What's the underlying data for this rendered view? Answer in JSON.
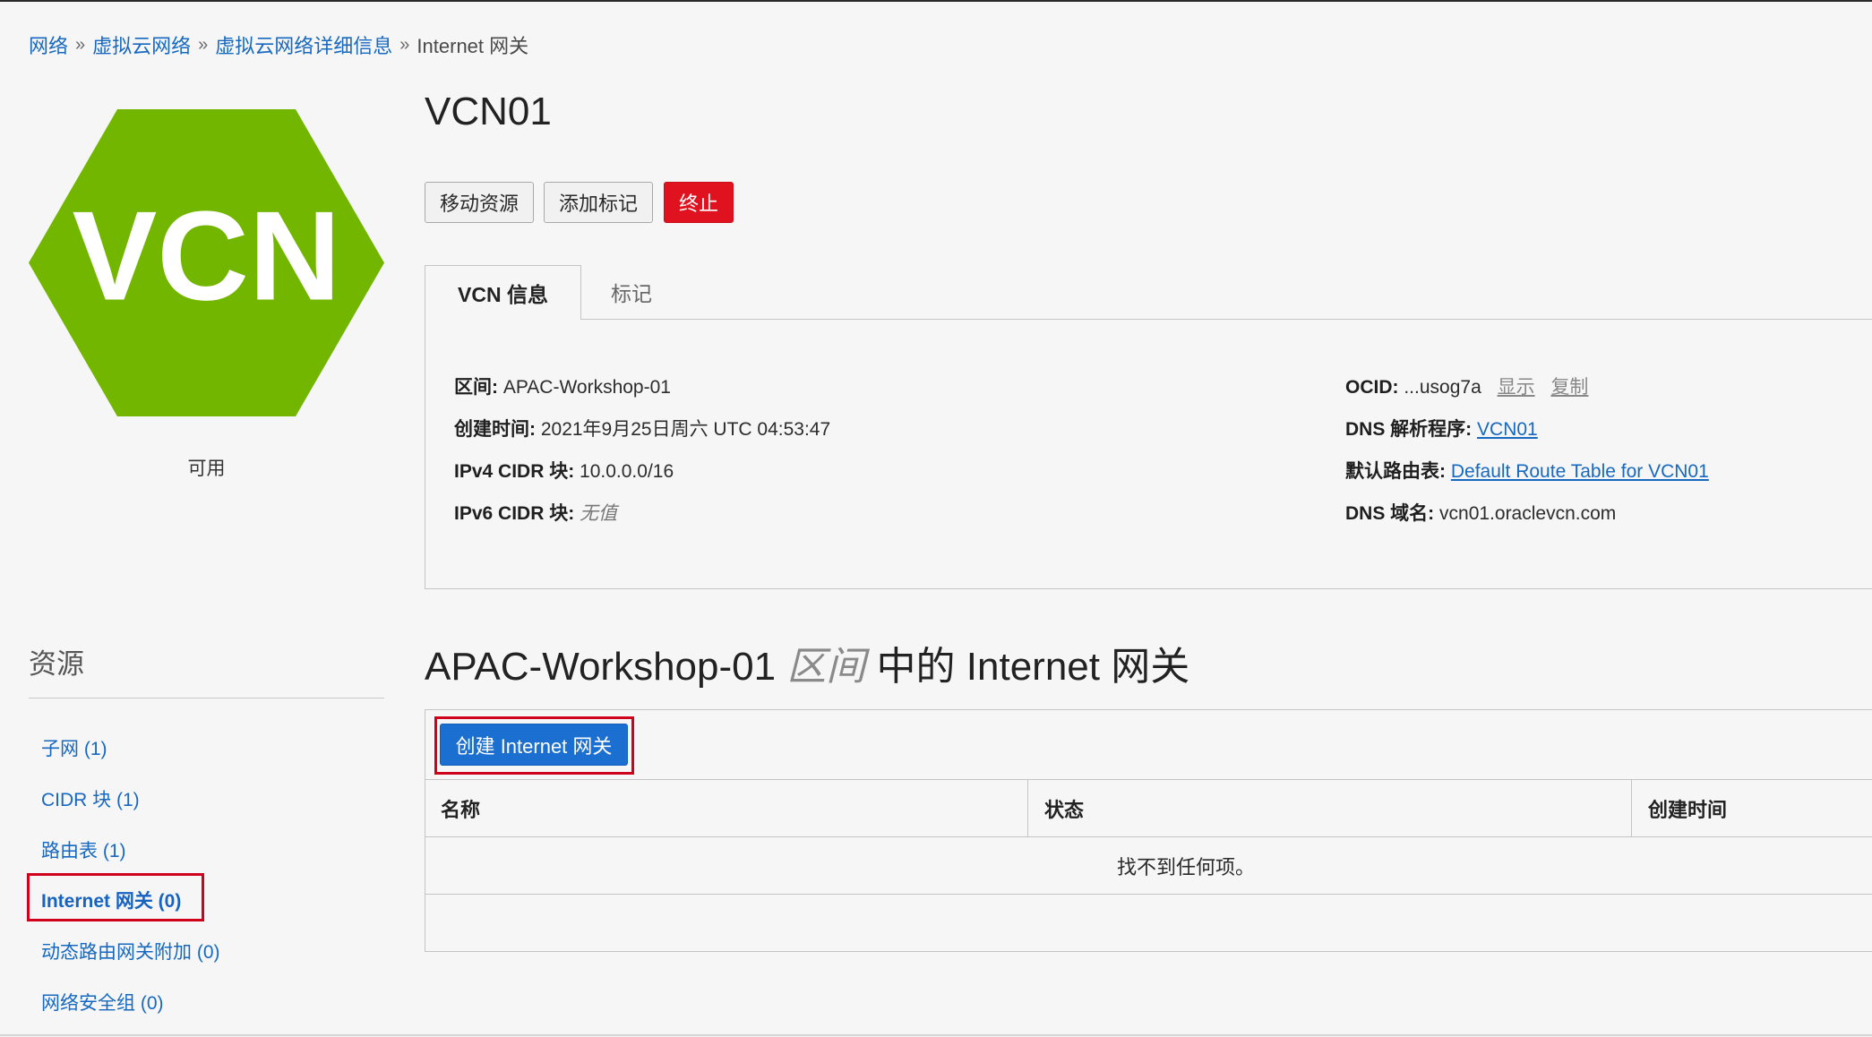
{
  "breadcrumb": {
    "items": [
      "网络",
      "虚拟云网络",
      "虚拟云网络详细信息"
    ],
    "separator": "»",
    "current": "Internet 网关"
  },
  "logo": {
    "text": "VCN",
    "color": "#72b600",
    "status": "可用"
  },
  "page": {
    "title": "VCN01"
  },
  "actions": {
    "move_label": "移动资源",
    "add_tags_label": "添加标记",
    "terminate_label": "终止"
  },
  "tabs": {
    "info_label": "VCN 信息",
    "tags_label": "标记"
  },
  "details": {
    "compartment_label": "区间:",
    "compartment_value": "APAC-Workshop-01",
    "created_label": "创建时间:",
    "created_value": "2021年9月25日周六 UTC 04:53:47",
    "ipv4_label": "IPv4 CIDR 块:",
    "ipv4_value": "10.0.0.0/16",
    "ipv6_label": "IPv6 CIDR 块:",
    "ipv6_value": "无值",
    "ocid_label": "OCID:",
    "ocid_value": "...usog7a",
    "ocid_show": "显示",
    "ocid_copy": "复制",
    "dns_resolver_label": "DNS 解析程序:",
    "dns_resolver_value": "VCN01",
    "route_table_label": "默认路由表:",
    "route_table_value": "Default Route Table for VCN01",
    "dns_domain_label": "DNS 域名:",
    "dns_domain_value": "vcn01.oraclevcn.com"
  },
  "resources": {
    "title": "资源",
    "items": [
      "子网 (1)",
      "CIDR 块 (1)",
      "路由表 (1)",
      "Internet 网关 (0)",
      "动态路由网关附加 (0)",
      "网络安全组 (0)"
    ]
  },
  "section": {
    "title_prefix": "APAC-Workshop-01",
    "title_scope": "区间",
    "title_suffix": "中的 Internet 网关"
  },
  "table": {
    "create_button": "创建 Internet 网关",
    "columns": [
      "名称",
      "状态",
      "创建时间"
    ],
    "empty_text": "找不到任何项。"
  },
  "colors": {
    "accent": "#1a6fd0",
    "danger": "#e0121f",
    "highlight": "#d0021b",
    "link": "#1769c0"
  }
}
